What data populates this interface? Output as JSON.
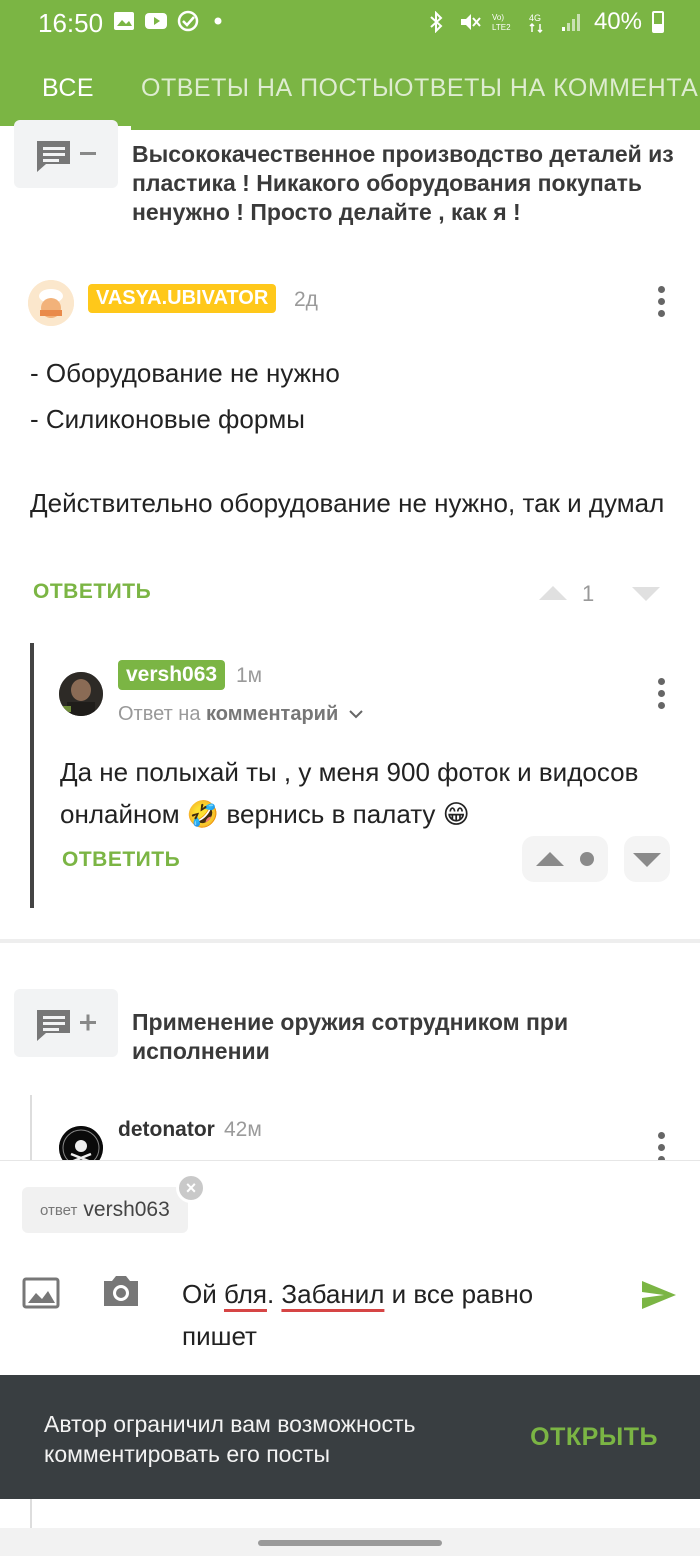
{
  "status_bar": {
    "time": "16:50",
    "battery": "40%",
    "network": "4G"
  },
  "tabs": [
    {
      "label": "ВСЕ",
      "active": true
    },
    {
      "label": "ОТВЕТЫ НА ПОСТЫ",
      "active": false
    },
    {
      "label": "ОТВЕТЫ НА КОММЕНТАР",
      "active": false
    }
  ],
  "post1": {
    "title": "Высококачественное производство деталей из пластика ! Никакого оборудования покупать ненужно ! Просто делайте , как я !",
    "icon_symbol": "−"
  },
  "comment1": {
    "author": "VASYA.UBIVATOR",
    "time": "2д",
    "line1": "- Оборудование не нужно",
    "line2": "- Силиконовые формы",
    "line3": "Действительно оборудование не нужно, так и думал",
    "reply_label": "ОТВЕТИТЬ",
    "votes": "1"
  },
  "comment2": {
    "author": "versh063",
    "time": "1м",
    "reply_to_prefix": "Ответ на",
    "reply_to_target": "комментарий",
    "text": "Да не полыхай ты , у меня 900 фоток и видосов онлайном 🤣 вернись в палату 😁",
    "reply_label": "ОТВЕТИТЬ"
  },
  "post2": {
    "title": "Применение оружия сотрудником при исполнении",
    "icon_symbol": "+"
  },
  "comment3": {
    "author": "detonator",
    "time": "42м"
  },
  "composer": {
    "reply_chip_prefix": "ответ",
    "reply_chip_name": "versh063",
    "text_part1": "Ой ",
    "text_word1": "бля",
    "text_part2": ". ",
    "text_word2": "Забанил",
    "text_part3": " и все равно пишет"
  },
  "snackbar": {
    "message": "Автор ограничил вам возможность комментировать его посты",
    "action": "ОТКРЫТЬ"
  },
  "colors": {
    "brand_green": "#7bb544",
    "badge_yellow": "#ffc81a",
    "snackbar_bg": "#393e41",
    "spell_error": "#d64545"
  }
}
